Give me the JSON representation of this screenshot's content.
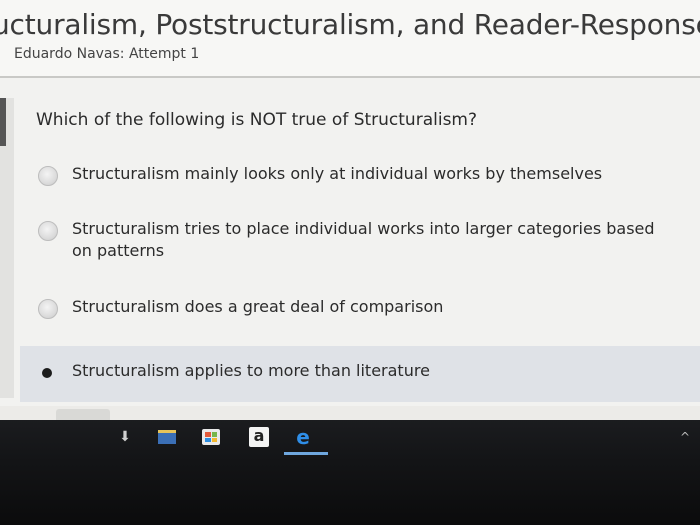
{
  "header": {
    "title_visible": "ucturalism, Poststructuralism, and Reader-Response Theo",
    "subtitle": "Eduardo Navas: Attempt 1"
  },
  "question": {
    "text": "Which of the following is NOT true of Structuralism?",
    "options": [
      {
        "label": "Structuralism mainly looks only at individual works by themselves",
        "selected": false
      },
      {
        "label": "Structuralism tries to place individual works into larger categories based on patterns",
        "selected": false
      },
      {
        "label": "Structuralism does a great deal of comparison",
        "selected": false
      },
      {
        "label": "Structuralism applies to more than literature",
        "selected": true
      }
    ]
  },
  "taskbar": {
    "icons": [
      "download-icon",
      "file-explorer-icon",
      "store-icon",
      "amazon-icon",
      "edge-icon"
    ],
    "amazon_glyph": "a",
    "edge_glyph": "e",
    "caret_glyph": "^"
  },
  "colors": {
    "selected_row_bg": "#dfe2e7",
    "taskbar_bg": "#131416",
    "edge_blue": "#2f8ee8"
  }
}
